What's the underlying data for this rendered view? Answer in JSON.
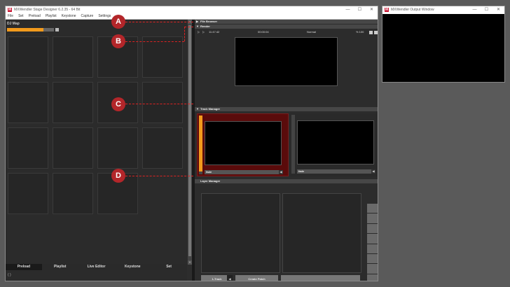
{
  "main_window": {
    "title": "MXWendler Stage Designer 6.2.35 - 64 Bit",
    "logo": "M",
    "controls": [
      "—",
      "☐",
      "✕"
    ],
    "menu": [
      "File",
      "Set",
      "Preload",
      "Playlist",
      "Keystone",
      "Capture",
      "Settings"
    ]
  },
  "left": {
    "map_label": "DJ Map",
    "progress": 0.77,
    "tabs": [
      "Preload",
      "Playlist",
      "Live Editor",
      "Keystone",
      "Set"
    ],
    "active_tab": "Preload",
    "status": "( )"
  },
  "right": {
    "file_browser": "File Browser",
    "render": "Render",
    "render_time": "11:47:42",
    "render_duration": "00:00:04",
    "render_mode": "Normal",
    "render_zoom": "% 100",
    "track_manager": "Track Manager",
    "track_a_fade": "fade",
    "track_b_fade": "fade",
    "layer_manager": "Layer Manager",
    "btn_track": "1-Track",
    "btn_create_patch": "Create Patch",
    "btn_blank": ""
  },
  "output_window": {
    "title": "MXWendler Output Window",
    "logo": "M",
    "controls": [
      "—",
      "☐",
      "✕"
    ]
  },
  "callouts": [
    "A",
    "B",
    "C",
    "D"
  ],
  "colors": {
    "accent": "#f29a1c",
    "callout": "#b3262a",
    "active_track": "#5a0b0b"
  }
}
